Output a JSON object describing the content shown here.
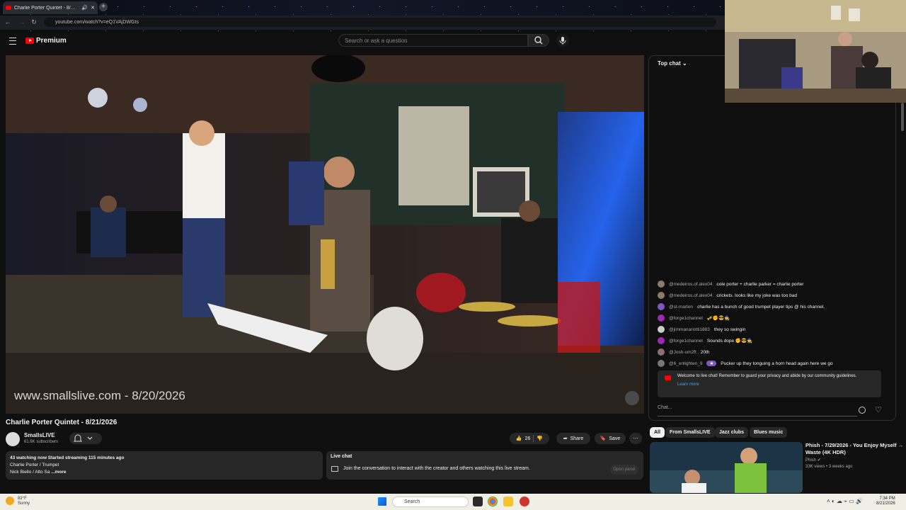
{
  "browser": {
    "tab_title": "Charlie Porter Quintet - 8/…",
    "url": "youtube.com/watch?v=eQ1VAjDWGts"
  },
  "youtube": {
    "logo_text": "Premium",
    "search_placeholder": "Search or ask a question"
  },
  "player": {
    "watermark": "www.smallslive.com - 8/20/2026"
  },
  "video": {
    "title": "Charlie Porter Quintet - 8/21/2026",
    "channel": "SmallsLIVE",
    "subscribers": "61.6K subscribers",
    "likes": "26",
    "share_label": "Share",
    "save_label": "Save"
  },
  "description": {
    "line1": "43 watching now  Started streaming 115 minutes ago",
    "line2": "Charlie Porter / Trumpet",
    "line3": "Nick Biello / Alto Sa",
    "more": "...more"
  },
  "live_chat_box": {
    "title": "Live chat",
    "message": "Join the conversation to interact with the creator and others watching this live stream.",
    "open_panel": "Open panel"
  },
  "chat": {
    "header": "Top chat",
    "messages": [
      {
        "author": "@medeiros.of.alex04",
        "text": "cole porter + charlie parker = charlie porter",
        "color": "#8d7a6a"
      },
      {
        "author": "@medeiros.of.alex04",
        "text": "crickets. looks like my joke was too bad",
        "color": "#8d7a6a"
      },
      {
        "author": "@st-marten",
        "text": "charlie has a bunch of good trumpet player tips @ his channel.",
        "color": "#7e57c2"
      },
      {
        "author": "@forge1channel",
        "text": "🎺✊😎🧙",
        "color": "#9c27b0"
      },
      {
        "author": "@jimmanariotti1883",
        "text": "they so swingin",
        "color": "#cccccc"
      },
      {
        "author": "@forge1channel",
        "text": "Sounds dope ✊😎🧙",
        "color": "#9c27b0"
      },
      {
        "author": "@Josh-um2ft",
        "text": "20th",
        "color": "#8e6f6f"
      },
      {
        "author": "@6_enlighten_9",
        "text": "Pucker up they tonguing a horn head again here we go",
        "color": "#777777"
      }
    ],
    "welcome": "Welcome to live chat! Remember to guard your privacy and abide by our community guidelines.",
    "learn_more": "Learn more",
    "input_placeholder": "Chat..."
  },
  "chips": [
    "All",
    "From SmallsLIVE",
    "Jazz clubs",
    "Blues music"
  ],
  "recommended": {
    "title": "Phish - 7/29/2026 - You Enjoy Myself → Waste (4K HDR)",
    "channel": "Phish",
    "meta": "33K views • 3 weeks ago"
  },
  "taskbar": {
    "temp": "82°F",
    "weather": "Sunny",
    "search": "Search",
    "time": "7:34 PM",
    "date": "8/21/2026"
  }
}
